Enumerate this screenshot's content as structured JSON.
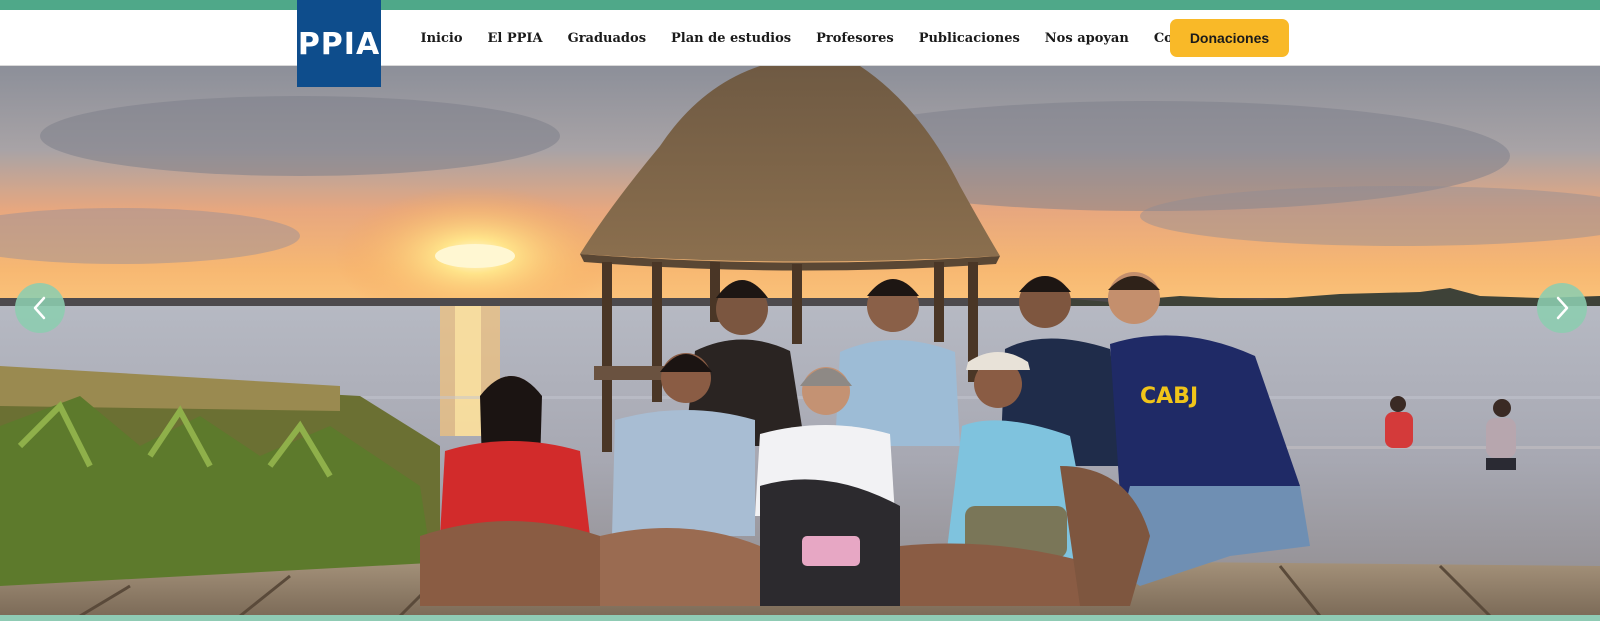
{
  "logo": {
    "text": "PPIA"
  },
  "nav": {
    "items": [
      {
        "label": "Inicio"
      },
      {
        "label": "El PPIA"
      },
      {
        "label": "Graduados"
      },
      {
        "label": "Plan de estudios"
      },
      {
        "label": "Profesores"
      },
      {
        "label": "Publicaciones"
      },
      {
        "label": "Nos apoyan"
      },
      {
        "label": "Contacto"
      }
    ],
    "donate_label": "Donaciones"
  },
  "hero": {
    "shirt_text": "CABJ",
    "prev_icon": "chevron-left-icon",
    "next_icon": "chevron-right-icon"
  },
  "colors": {
    "top_strip": "#4fa889",
    "logo_bg": "#0e4d8c",
    "donate_bg": "#f9b928",
    "arrow_bg": "#8ccdaf",
    "bottom_strip": "#8fcbb4"
  }
}
